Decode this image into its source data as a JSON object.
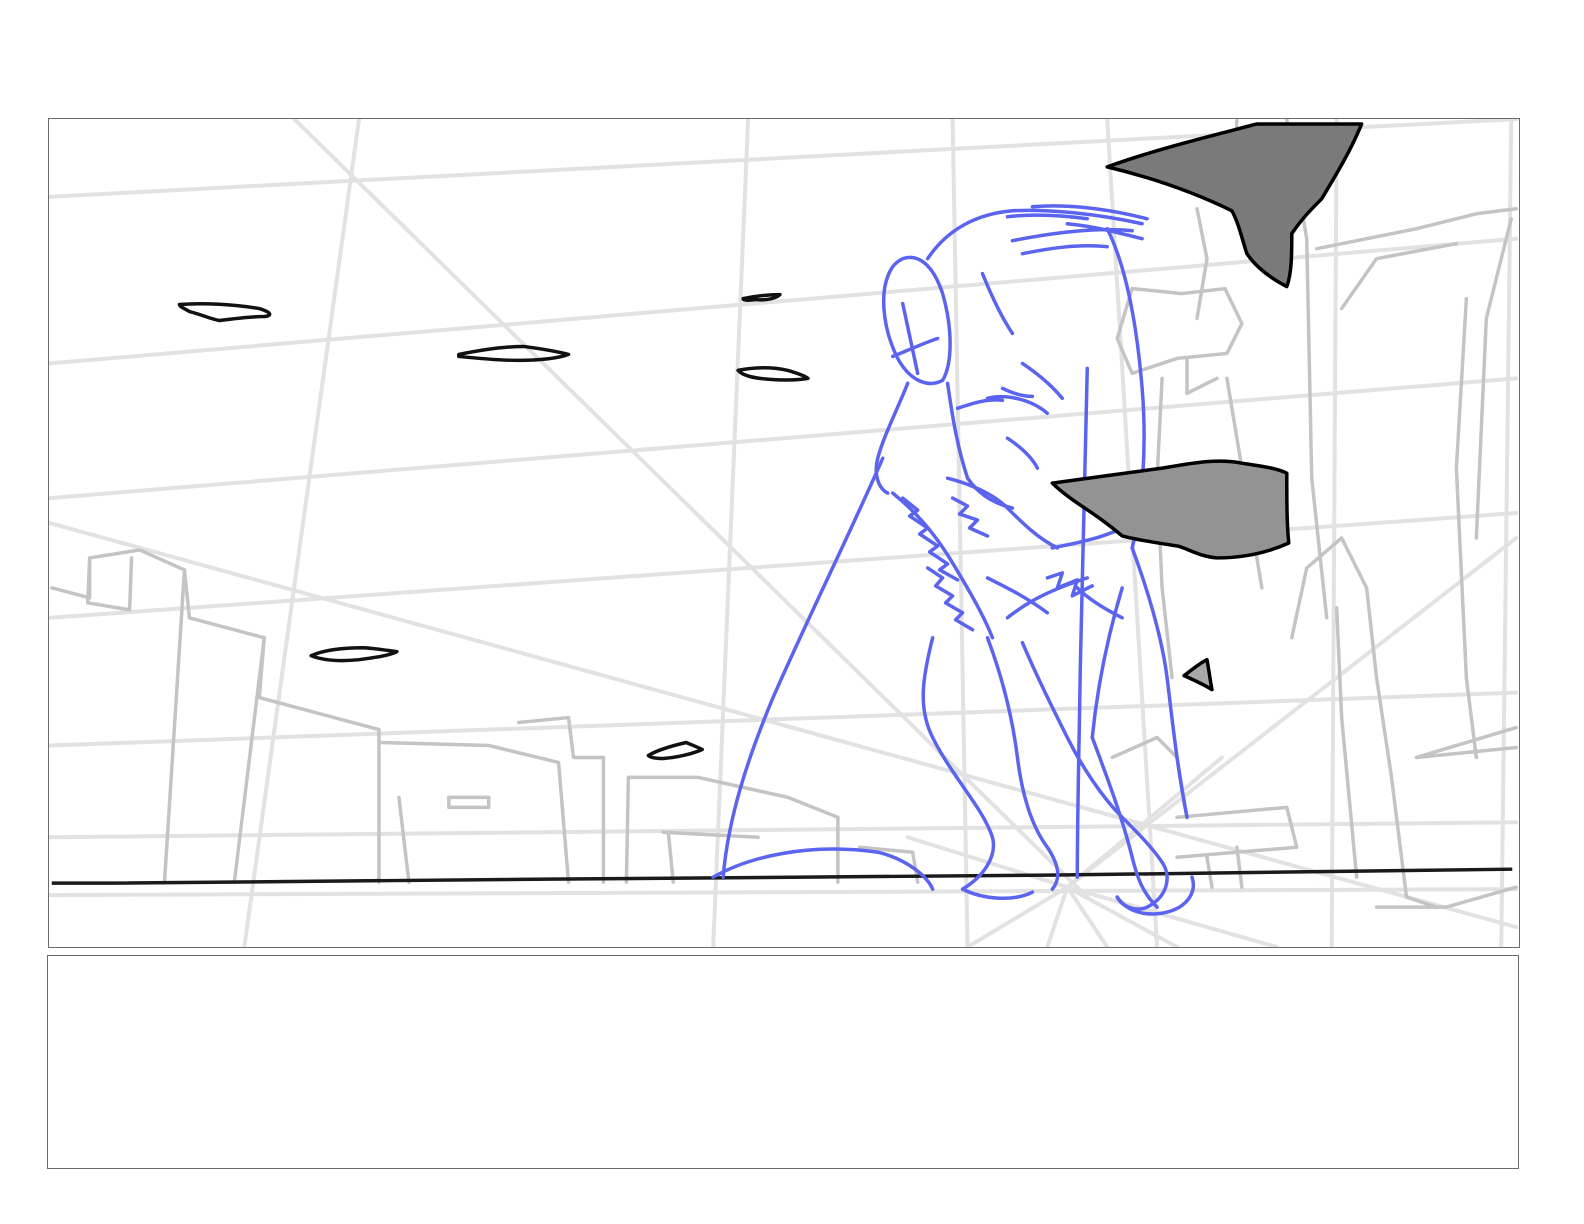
{
  "storyboard": {
    "drawing_panel": {
      "colors": {
        "perspective_grid": "#e2e2e2",
        "background_sketch": "#c4c4c4",
        "figure_sketch": "#5a64ee",
        "ink": "#111111",
        "shard_fill_dark": "#7a7a7a",
        "shard_fill_mid": "#939393",
        "shard_fill_light": "#a8a8a8"
      }
    },
    "notes_panel": {
      "text": ""
    }
  }
}
